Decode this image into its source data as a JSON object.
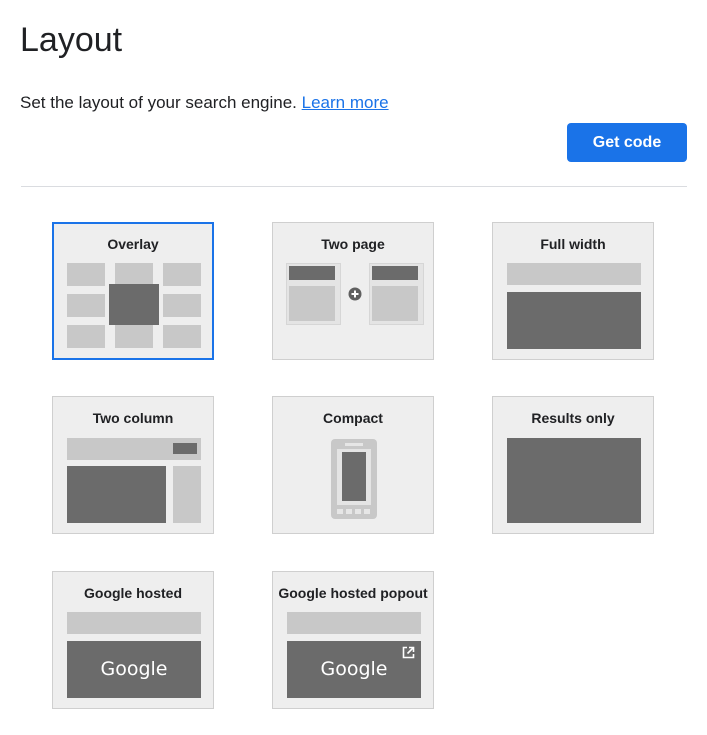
{
  "header": {
    "title": "Layout",
    "description": "Set the layout of your search engine.",
    "learn_more": "Learn more",
    "get_code": "Get code"
  },
  "layouts": [
    {
      "label": "Overlay",
      "selected": true
    },
    {
      "label": "Two page",
      "selected": false
    },
    {
      "label": "Full width",
      "selected": false
    },
    {
      "label": "Two column",
      "selected": false
    },
    {
      "label": "Compact",
      "selected": false
    },
    {
      "label": "Results only",
      "selected": false
    },
    {
      "label": "Google hosted",
      "selected": false
    },
    {
      "label": "Google hosted popout",
      "selected": false
    }
  ],
  "google_logo_text": "Google",
  "colors": {
    "accent": "#1a73e8",
    "card_bg": "#eeeeee",
    "block_light": "#c8c8c8",
    "block_dark": "#6b6b6b"
  }
}
